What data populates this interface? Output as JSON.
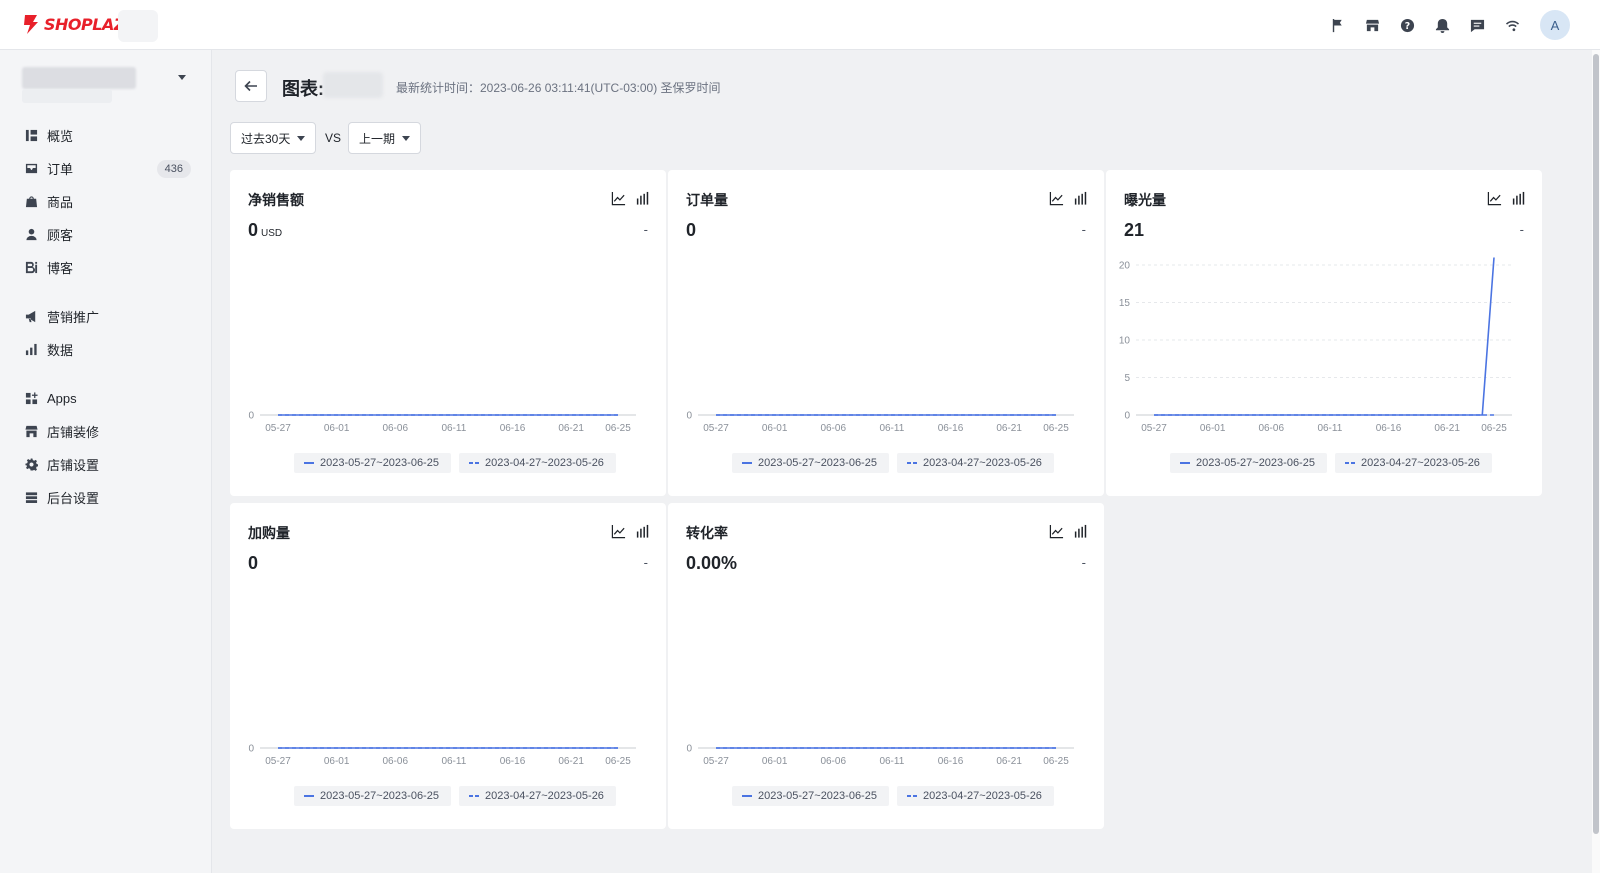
{
  "app": {
    "logo_text": "SHOPLAZZA",
    "avatar_letter": "A"
  },
  "topbar": {
    "icons": [
      "flag-icon",
      "store-icon",
      "help-icon",
      "bell-icon",
      "chat-icon",
      "wifi-icon"
    ]
  },
  "sidebar": {
    "items": [
      {
        "label": "概览",
        "icon": "overview-icon"
      },
      {
        "label": "订单",
        "icon": "orders-icon",
        "badge": "436"
      },
      {
        "label": "商品",
        "icon": "products-icon"
      },
      {
        "label": "顾客",
        "icon": "customers-icon"
      },
      {
        "label": "博客",
        "icon": "blog-icon"
      },
      {
        "label": "营销推广",
        "icon": "marketing-icon"
      },
      {
        "label": "数据",
        "icon": "analytics-icon"
      },
      {
        "label": "Apps",
        "icon": "apps-icon"
      },
      {
        "label": "店铺装修",
        "icon": "storefront-icon"
      },
      {
        "label": "店铺设置",
        "icon": "settings-icon"
      },
      {
        "label": "后台设置",
        "icon": "admin-settings-icon"
      }
    ]
  },
  "header": {
    "title": "图表:",
    "stat_time": "最新统计时间：2023-06-26 03:11:41(UTC-03:00) 圣保罗时间"
  },
  "filters": {
    "range": "过去30天",
    "vs": "VS",
    "compare": "上一期"
  },
  "accent_color": "#4b74e2",
  "chart_data": [
    {
      "type": "line",
      "title": "净销售额",
      "value": "0",
      "unit": "USD",
      "delta": "-",
      "x": [
        "05-27",
        "05-28",
        "05-29",
        "05-30",
        "05-31",
        "06-01",
        "06-02",
        "06-03",
        "06-04",
        "06-05",
        "06-06",
        "06-07",
        "06-08",
        "06-09",
        "06-10",
        "06-11",
        "06-12",
        "06-13",
        "06-14",
        "06-15",
        "06-16",
        "06-17",
        "06-18",
        "06-19",
        "06-20",
        "06-21",
        "06-22",
        "06-23",
        "06-24",
        "06-25"
      ],
      "xticks": [
        "05-27",
        "06-01",
        "06-06",
        "06-11",
        "06-16",
        "06-21",
        "06-25"
      ],
      "yticks": [
        0
      ],
      "ylim": [
        0,
        1
      ],
      "series": [
        {
          "name": "2023-05-27~2023-06-25",
          "style": "solid",
          "values": [
            0,
            0,
            0,
            0,
            0,
            0,
            0,
            0,
            0,
            0,
            0,
            0,
            0,
            0,
            0,
            0,
            0,
            0,
            0,
            0,
            0,
            0,
            0,
            0,
            0,
            0,
            0,
            0,
            0,
            0
          ]
        },
        {
          "name": "2023-04-27~2023-05-26",
          "style": "dashed",
          "values": [
            0,
            0,
            0,
            0,
            0,
            0,
            0,
            0,
            0,
            0,
            0,
            0,
            0,
            0,
            0,
            0,
            0,
            0,
            0,
            0,
            0,
            0,
            0,
            0,
            0,
            0,
            0,
            0,
            0,
            0
          ]
        }
      ]
    },
    {
      "type": "line",
      "title": "订单量",
      "value": "0",
      "unit": "",
      "delta": "-",
      "x": [
        "05-27",
        "05-28",
        "05-29",
        "05-30",
        "05-31",
        "06-01",
        "06-02",
        "06-03",
        "06-04",
        "06-05",
        "06-06",
        "06-07",
        "06-08",
        "06-09",
        "06-10",
        "06-11",
        "06-12",
        "06-13",
        "06-14",
        "06-15",
        "06-16",
        "06-17",
        "06-18",
        "06-19",
        "06-20",
        "06-21",
        "06-22",
        "06-23",
        "06-24",
        "06-25"
      ],
      "xticks": [
        "05-27",
        "06-01",
        "06-06",
        "06-11",
        "06-16",
        "06-21",
        "06-25"
      ],
      "yticks": [
        0
      ],
      "ylim": [
        0,
        1
      ],
      "series": [
        {
          "name": "2023-05-27~2023-06-25",
          "style": "solid",
          "values": [
            0,
            0,
            0,
            0,
            0,
            0,
            0,
            0,
            0,
            0,
            0,
            0,
            0,
            0,
            0,
            0,
            0,
            0,
            0,
            0,
            0,
            0,
            0,
            0,
            0,
            0,
            0,
            0,
            0,
            0
          ]
        },
        {
          "name": "2023-04-27~2023-05-26",
          "style": "dashed",
          "values": [
            0,
            0,
            0,
            0,
            0,
            0,
            0,
            0,
            0,
            0,
            0,
            0,
            0,
            0,
            0,
            0,
            0,
            0,
            0,
            0,
            0,
            0,
            0,
            0,
            0,
            0,
            0,
            0,
            0,
            0
          ]
        }
      ]
    },
    {
      "type": "line",
      "title": "曝光量",
      "value": "21",
      "unit": "",
      "delta": "-",
      "x": [
        "05-27",
        "05-28",
        "05-29",
        "05-30",
        "05-31",
        "06-01",
        "06-02",
        "06-03",
        "06-04",
        "06-05",
        "06-06",
        "06-07",
        "06-08",
        "06-09",
        "06-10",
        "06-11",
        "06-12",
        "06-13",
        "06-14",
        "06-15",
        "06-16",
        "06-17",
        "06-18",
        "06-19",
        "06-20",
        "06-21",
        "06-22",
        "06-23",
        "06-24",
        "06-25"
      ],
      "xticks": [
        "05-27",
        "06-01",
        "06-06",
        "06-11",
        "06-16",
        "06-21",
        "06-25"
      ],
      "yticks": [
        0,
        5,
        10,
        15,
        20
      ],
      "ylim": [
        0,
        20
      ],
      "grid": true,
      "series": [
        {
          "name": "2023-05-27~2023-06-25",
          "style": "solid",
          "values": [
            0,
            0,
            0,
            0,
            0,
            0,
            0,
            0,
            0,
            0,
            0,
            0,
            0,
            0,
            0,
            0,
            0,
            0,
            0,
            0,
            0,
            0,
            0,
            0,
            0,
            0,
            0,
            0,
            0,
            21
          ]
        },
        {
          "name": "2023-04-27~2023-05-26",
          "style": "dashed",
          "values": [
            0,
            0,
            0,
            0,
            0,
            0,
            0,
            0,
            0,
            0,
            0,
            0,
            0,
            0,
            0,
            0,
            0,
            0,
            0,
            0,
            0,
            0,
            0,
            0,
            0,
            0,
            0,
            0,
            0,
            0
          ]
        }
      ]
    },
    {
      "type": "line",
      "title": "加购量",
      "value": "0",
      "unit": "",
      "delta": "-",
      "x": [
        "05-27",
        "05-28",
        "05-29",
        "05-30",
        "05-31",
        "06-01",
        "06-02",
        "06-03",
        "06-04",
        "06-05",
        "06-06",
        "06-07",
        "06-08",
        "06-09",
        "06-10",
        "06-11",
        "06-12",
        "06-13",
        "06-14",
        "06-15",
        "06-16",
        "06-17",
        "06-18",
        "06-19",
        "06-20",
        "06-21",
        "06-22",
        "06-23",
        "06-24",
        "06-25"
      ],
      "xticks": [
        "05-27",
        "06-01",
        "06-06",
        "06-11",
        "06-16",
        "06-21",
        "06-25"
      ],
      "yticks": [
        0
      ],
      "ylim": [
        0,
        1
      ],
      "series": [
        {
          "name": "2023-05-27~2023-06-25",
          "style": "solid",
          "values": [
            0,
            0,
            0,
            0,
            0,
            0,
            0,
            0,
            0,
            0,
            0,
            0,
            0,
            0,
            0,
            0,
            0,
            0,
            0,
            0,
            0,
            0,
            0,
            0,
            0,
            0,
            0,
            0,
            0,
            0
          ]
        },
        {
          "name": "2023-04-27~2023-05-26",
          "style": "dashed",
          "values": [
            0,
            0,
            0,
            0,
            0,
            0,
            0,
            0,
            0,
            0,
            0,
            0,
            0,
            0,
            0,
            0,
            0,
            0,
            0,
            0,
            0,
            0,
            0,
            0,
            0,
            0,
            0,
            0,
            0,
            0
          ]
        }
      ]
    },
    {
      "type": "line",
      "title": "转化率",
      "value": "0.00%",
      "unit": "",
      "delta": "-",
      "x": [
        "05-27",
        "05-28",
        "05-29",
        "05-30",
        "05-31",
        "06-01",
        "06-02",
        "06-03",
        "06-04",
        "06-05",
        "06-06",
        "06-07",
        "06-08",
        "06-09",
        "06-10",
        "06-11",
        "06-12",
        "06-13",
        "06-14",
        "06-15",
        "06-16",
        "06-17",
        "06-18",
        "06-19",
        "06-20",
        "06-21",
        "06-22",
        "06-23",
        "06-24",
        "06-25"
      ],
      "xticks": [
        "05-27",
        "06-01",
        "06-06",
        "06-11",
        "06-16",
        "06-21",
        "06-25"
      ],
      "yticks": [
        0
      ],
      "ylim": [
        0,
        1
      ],
      "series": [
        {
          "name": "2023-05-27~2023-06-25",
          "style": "solid",
          "values": [
            0,
            0,
            0,
            0,
            0,
            0,
            0,
            0,
            0,
            0,
            0,
            0,
            0,
            0,
            0,
            0,
            0,
            0,
            0,
            0,
            0,
            0,
            0,
            0,
            0,
            0,
            0,
            0,
            0,
            0
          ]
        },
        {
          "name": "2023-04-27~2023-05-26",
          "style": "dashed",
          "values": [
            0,
            0,
            0,
            0,
            0,
            0,
            0,
            0,
            0,
            0,
            0,
            0,
            0,
            0,
            0,
            0,
            0,
            0,
            0,
            0,
            0,
            0,
            0,
            0,
            0,
            0,
            0,
            0,
            0,
            0
          ]
        }
      ]
    }
  ]
}
